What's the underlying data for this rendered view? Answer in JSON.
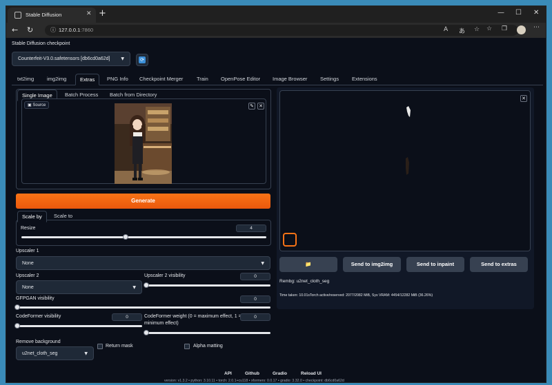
{
  "browser": {
    "tab_title": "Stable Diffusion",
    "url_host": "127.0.0.1",
    "url_port": ":7860"
  },
  "checkpoint": {
    "label": "Stable Diffusion checkpoint",
    "value": "Counterfeit-V3.0.safetensors [db6cd0a62d]"
  },
  "main_tabs": [
    "txt2img",
    "img2img",
    "Extras",
    "PNG Info",
    "Checkpoint Merger",
    "Train",
    "OpenPose Editor",
    "Image Browser",
    "Settings",
    "Extensions"
  ],
  "sub_tabs": [
    "Single Image",
    "Batch Process",
    "Batch from Directory"
  ],
  "source_label": "Source",
  "generate_label": "Generate",
  "scale_tabs": [
    "Scale by",
    "Scale to"
  ],
  "resize": {
    "label": "Resize",
    "value": "4",
    "fraction": 0.41
  },
  "upscaler1": {
    "label": "Upscaler 1",
    "value": "None"
  },
  "upscaler2": {
    "label": "Upscaler 2",
    "value": "None"
  },
  "upscaler2_visibility": {
    "label": "Upscaler 2 visibility",
    "value": "0",
    "fraction": 0
  },
  "gfpgan": {
    "label": "GFPGAN visibility",
    "value": "0",
    "fraction": 0
  },
  "codeformer_vis": {
    "label": "CodeFormer visibility",
    "value": "0",
    "fraction": 0
  },
  "codeformer_weight": {
    "label": "CodeFormer weight (0 = maximum effect, 1 = minimum effect)",
    "label_line1": "CodeFormer weight (0 = maximum effect, 1 =",
    "label_line2": "minimum effect)",
    "value": "0",
    "fraction": 0
  },
  "remove_bg": {
    "label": "Remove background",
    "value": "u2net_cloth_seg"
  },
  "return_mask": {
    "label": "Return mask",
    "checked": false
  },
  "alpha_matting": {
    "label": "Alpha matting",
    "checked": false
  },
  "output": {
    "send_buttons": [
      "Send to img2img",
      "Send to inpaint",
      "Send to extras"
    ],
    "result_label": "Rembg: u2net_cloth_seg",
    "timing": "Time taken: 10.01sTorch active/reserved: 2077/2082 MiB, Sys VRAM: 4454/12282 MiB (36.26%)"
  },
  "footer": {
    "links": [
      "API",
      "Github",
      "Gradio",
      "Reload UI"
    ],
    "version": "version: v1.3.2  •  python: 3.10.11  •  torch: 2.0.1+cu118  •  xformers: 0.0.17  •  gradio: 3.32.0  •  checkpoint: db6cd0a62d"
  },
  "colors": {
    "accent": "#f97316",
    "background": "#0b0f19",
    "panel_border": "#374151"
  },
  "icons": [
    "refresh-icon",
    "folder-icon",
    "image-icon",
    "pencil-icon",
    "close-icon",
    "chevron-down-icon"
  ]
}
